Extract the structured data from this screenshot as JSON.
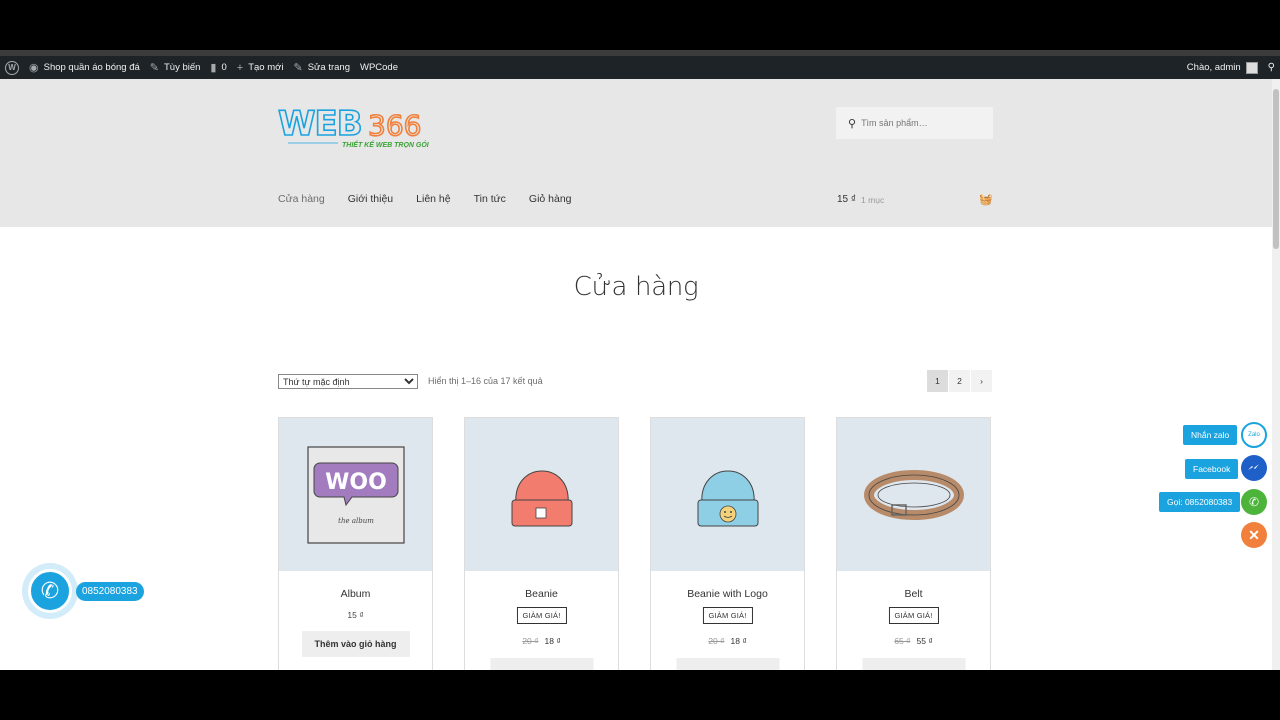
{
  "admin_bar": {
    "site_name": "Shop quần áo bóng đá",
    "customize": "Tùy biến",
    "comments_count": "0",
    "new": "Tạo mới",
    "edit_page": "Sửa trang",
    "wpcode": "WPCode",
    "greeting": "Chào, admin"
  },
  "header": {
    "logo_text": "WEB366",
    "logo_tagline": "THIẾT KẾ WEB TRỌN GÓI",
    "search_placeholder": "Tìm sản phẩm…",
    "nav": [
      "Cửa hàng",
      "Giới thiệu",
      "Liên hệ",
      "Tin tức",
      "Giỏ hàng"
    ],
    "cart_total": "15 ₫",
    "cart_count": "1 mục"
  },
  "page": {
    "title": "Cửa hàng",
    "orderby_selected": "Thứ tự mặc định",
    "result_count": "Hiển thị 1–16 của 17 kết quả",
    "pages": [
      "1",
      "2"
    ],
    "next_icon": "›"
  },
  "products": [
    {
      "name": "Album",
      "price": "15 ₫",
      "button": "Thêm vào giỏ hàng"
    },
    {
      "name": "Beanie",
      "badge": "GIẢM GIÁ!",
      "old_price": "20 ₫",
      "new_price": "18 ₫"
    },
    {
      "name": "Beanie with Logo",
      "badge": "GIẢM GIÁ!",
      "old_price": "20 ₫",
      "new_price": "18 ₫"
    },
    {
      "name": "Belt",
      "badge": "GIẢM GIÁ!",
      "old_price": "65 ₫",
      "new_price": "55 ₫"
    }
  ],
  "contact": {
    "zalo_label": "Nhắn zalo",
    "facebook_label": "Facebook",
    "call_label": "Gọi: 0852080383",
    "phone_number": "0852080383",
    "zalo_icon_text": "Zalo"
  },
  "colors": {
    "accent": "#1ba3e0",
    "zalo": "#1ba3e0",
    "messenger": "#1f5fc8",
    "call": "#4cb33b",
    "close": "#f0803c"
  }
}
